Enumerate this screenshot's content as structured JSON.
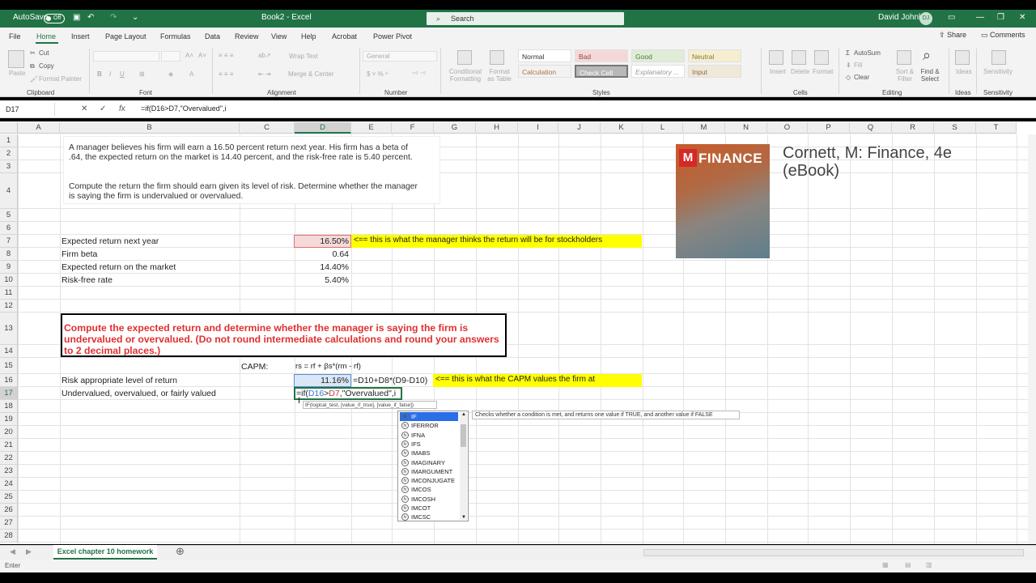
{
  "window": {
    "autosave_label": "AutoSave",
    "autosave_state": "Off",
    "title": "Book2  -  Excel",
    "search_label": "Search",
    "user_name": "David Johnk",
    "user_initials": "DJ"
  },
  "menu": {
    "tabs": [
      "File",
      "Home",
      "Insert",
      "Page Layout",
      "Formulas",
      "Data",
      "Review",
      "View",
      "Help",
      "Acrobat",
      "Power Pivot"
    ],
    "share_label": "Share",
    "comments_label": "Comments"
  },
  "ribbon": {
    "groups": [
      "Clipboard",
      "Font",
      "Alignment",
      "Number",
      "Styles",
      "Cells",
      "Editing",
      "Ideas",
      "Sensitivity"
    ],
    "cut": "Cut",
    "copy": "Copy",
    "format_painter": "Format Painter",
    "paste": "Paste",
    "wrap_text": "Wrap Text",
    "merge_center": "Merge & Center",
    "number_format": "General",
    "conditional_formatting": "Conditional Formatting",
    "format_as_table": "Format as Table",
    "styles": [
      "Normal",
      "Bad",
      "Good",
      "Neutral",
      "Calculation",
      "Check Cell",
      "Explanatory ...",
      "Input"
    ],
    "insert": "Insert",
    "delete": "Delete",
    "format": "Format",
    "autosum": "AutoSum",
    "fill": "Fill",
    "clear": "Clear",
    "sort_filter": "Sort & Filter",
    "find_select": "Find & Select",
    "ideas": "Ideas",
    "sensitivity": "Sensitivity"
  },
  "formula_bar": {
    "name_box": "D17",
    "cancel": "✕",
    "enter": "✓",
    "fx": "fx",
    "formula": "=if(D16>D7,\"Overvalued\",i"
  },
  "columns": [
    "A",
    "B",
    "C",
    "D",
    "E",
    "F",
    "G",
    "H",
    "I",
    "J",
    "K",
    "L",
    "M",
    "N",
    "O",
    "P",
    "Q",
    "R",
    "S",
    "T"
  ],
  "rows": [
    "1",
    "2",
    "3",
    "4",
    "5",
    "6",
    "7",
    "8",
    "9",
    "10",
    "11",
    "12",
    "13",
    "14",
    "15",
    "16",
    "17",
    "18",
    "19",
    "20",
    "21",
    "22",
    "23",
    "24",
    "25",
    "26",
    "27",
    "28"
  ],
  "problem": {
    "line1": "A manager believes his firm will earn a 16.50 percent return next year. His firm has a beta of",
    "line2": ".64, the expected return on the market is 14.40 percent, and the risk-free rate is 5.40 percent.",
    "line3": "Compute the return the firm should earn given its level of risk. Determine whether the manager",
    "line4": "is saying the firm is undervalued or overvalued."
  },
  "inputs": {
    "expected_return_label": "Expected return next year",
    "expected_return_value": "16.50%",
    "firm_beta_label": "Firm beta",
    "firm_beta_value": "0.64",
    "market_return_label": "Expected return on the market",
    "market_return_value": "14.40%",
    "risk_free_label": "Risk-free rate",
    "risk_free_value": "5.40%",
    "note_d7": "<== this is what the manager thinks the return will be for stockholders"
  },
  "instruction": "Compute the expected return and determine whether the manager is saying the firm is undervalued or overvalued. (Do not round intermediate calculations and round your answers to 2 decimal places.)",
  "capm": {
    "label": "CAPM:",
    "formula": "rs = rf + βs*(rm - rf)",
    "risk_label": "Risk appropriate level of return",
    "risk_value": "11.16%",
    "risk_formula": "=D10+D8*(D9-D10)",
    "note_d16": "<== this is what the CAPM values the firm at",
    "valuation_label": "Undervalued, overvalued, or fairly valued",
    "edit_pre": "=if(",
    "edit_ref1": "D16",
    "edit_op": ">",
    "edit_ref2": "D7",
    "edit_post": ",\"Overvalued\",i"
  },
  "book": {
    "logo": "M",
    "cover_word": "FINANCE",
    "title_line1": "Cornett, M: Finance, 4e",
    "title_line2": "(eBook)"
  },
  "autocomplete": {
    "arg_hint": "IF(logical_test, [value_if_true], [value_if_false])",
    "items": [
      "IF",
      "IFERROR",
      "IFNA",
      "IFS",
      "IMABS",
      "IMAGINARY",
      "IMARGUMENT",
      "IMCONJUGATE",
      "IMCOS",
      "IMCOSH",
      "IMCOT",
      "IMCSC"
    ],
    "tooltip": "Checks whether a condition is met, and returns one value if TRUE, and another value if FALSE"
  },
  "sheet_tab": "Excel chapter 10 homework",
  "status": "Enter",
  "colors": {
    "excel_green": "#217346",
    "highlight_yellow": "#ffff00",
    "instruction_red": "#e03030"
  }
}
